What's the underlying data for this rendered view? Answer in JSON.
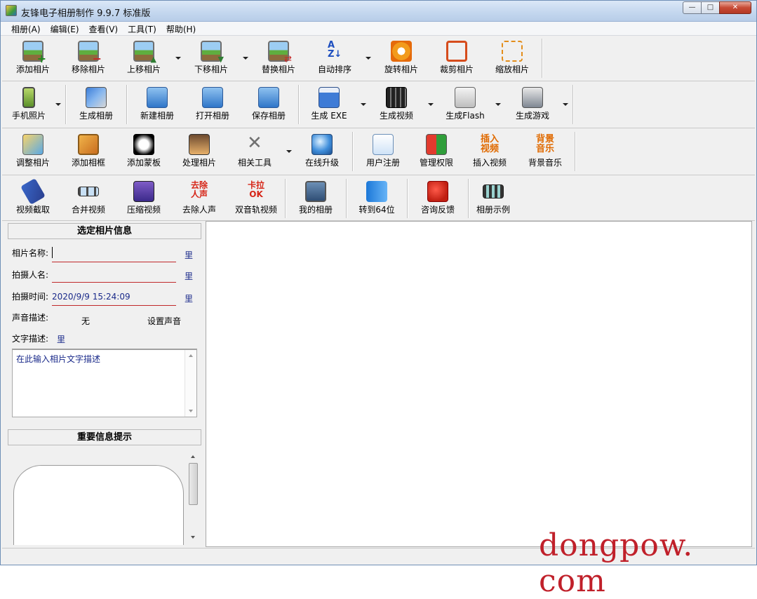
{
  "window": {
    "title": "友锋电子相册制作 9.9.7 标准版",
    "controls": {
      "minimize": "—",
      "maximize": "□",
      "close": "✕"
    }
  },
  "menu": [
    "相册(A)",
    "编辑(E)",
    "查看(V)",
    "工具(T)",
    "帮助(H)"
  ],
  "toolbar1": [
    {
      "label": "添加相片",
      "icon": "add-photo-icon"
    },
    {
      "label": "移除相片",
      "icon": "remove-photo-icon"
    },
    {
      "label": "上移相片",
      "icon": "move-up-photo-icon"
    },
    {
      "label": "下移相片",
      "icon": "move-down-photo-icon"
    },
    {
      "label": "替换相片",
      "icon": "replace-photo-icon"
    },
    {
      "label": "自动排序",
      "icon": "sort-az-icon"
    },
    {
      "label": "旋转相片",
      "icon": "rotate-icon"
    },
    {
      "label": "裁剪相片",
      "icon": "crop-icon"
    },
    {
      "label": "缩放相片",
      "icon": "zoom-icon"
    }
  ],
  "toolbar2": [
    {
      "label": "手机照片",
      "icon": "phone-icon"
    },
    {
      "label": "生成相册",
      "icon": "build-album-icon"
    },
    {
      "label": "新建相册",
      "icon": "new-album-icon"
    },
    {
      "label": "打开相册",
      "icon": "open-album-icon"
    },
    {
      "label": "保存相册",
      "icon": "save-album-icon"
    },
    {
      "label": "生成 EXE",
      "icon": "exe-icon"
    },
    {
      "label": "生成视频",
      "icon": "video-icon"
    },
    {
      "label": "生成Flash",
      "icon": "flash-icon"
    },
    {
      "label": "生成游戏",
      "icon": "game-icon"
    }
  ],
  "toolbar3": [
    {
      "label": "调整相片",
      "icon": "adjust-photo-icon"
    },
    {
      "label": "添加相框",
      "icon": "frame-icon"
    },
    {
      "label": "添加蒙板",
      "icon": "mask-icon"
    },
    {
      "label": "处理相片",
      "icon": "process-photo-icon"
    },
    {
      "label": "相关工具",
      "icon": "tools-icon"
    },
    {
      "label": "在线升级",
      "icon": "upgrade-globe-icon"
    },
    {
      "label": "用户注册",
      "icon": "register-icon"
    },
    {
      "label": "管理权限",
      "icon": "permission-shield-icon"
    },
    {
      "label": "插入视频",
      "icon": "insert-video-icon",
      "glyph": "插入视频"
    },
    {
      "label": "背景音乐",
      "icon": "background-music-icon",
      "glyph": "背景音乐"
    }
  ],
  "toolbar4": [
    {
      "label": "视频截取",
      "icon": "video-cut-icon"
    },
    {
      "label": "合并视频",
      "icon": "merge-video-icon"
    },
    {
      "label": "压缩视频",
      "icon": "compress-video-icon"
    },
    {
      "label": "去除人声",
      "icon": "remove-voice-icon",
      "glyph": "去除人声"
    },
    {
      "label": "双音轨视频",
      "icon": "dual-track-icon",
      "glyph": "卡拉OK"
    },
    {
      "label": "我的相册",
      "icon": "my-album-icon"
    },
    {
      "label": "转到64位",
      "icon": "to-64bit-icon"
    },
    {
      "label": "咨询反馈",
      "icon": "feedback-icon"
    },
    {
      "label": "相册示例",
      "icon": "example-icon"
    }
  ],
  "photo_info": {
    "title": "选定相片信息",
    "name_label": "相片名称:",
    "name_value": "",
    "photographer_label": "拍摄人名:",
    "photographer_value": "",
    "time_label": "拍摄时间:",
    "time_value": "2020/9/9 15:24:09",
    "edit_glyph": "里",
    "sound_label": "声音描述:",
    "sound_value": "无",
    "set_sound": "设置声音",
    "text_label": "文字描述:",
    "text_placeholder": "在此输入相片文字描述"
  },
  "tips": {
    "title": "重要信息提示"
  },
  "watermark": "dongpow. com",
  "colors": {
    "field_underline": "#c0292a",
    "value_text": "#1a2a8a",
    "watermark": "#c0202a"
  }
}
